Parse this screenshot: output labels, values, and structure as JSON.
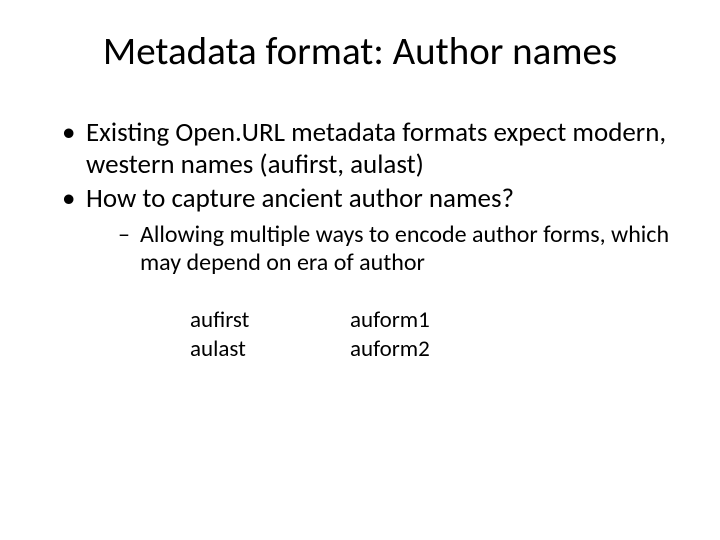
{
  "title": "Metadata format: Author names",
  "bullets": {
    "b1": "Existing Open.URL metadata formats expect modern, western names (aufirst, aulast)",
    "b2": "How to capture ancient author names?",
    "sub1": "Allowing multiple ways to encode author forms, which may depend on era of author"
  },
  "columns": {
    "left": {
      "r1": "aufirst",
      "r2": "aulast"
    },
    "right": {
      "r1": "auform1",
      "r2": "auform2"
    }
  }
}
